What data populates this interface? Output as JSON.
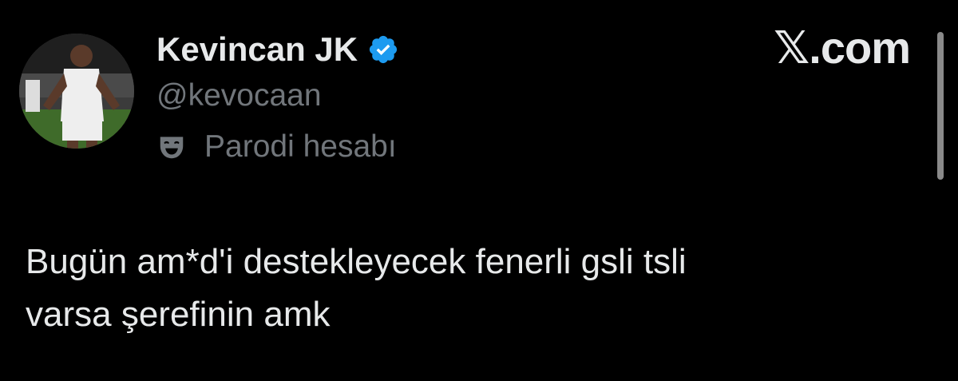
{
  "profile": {
    "display_name": "Kevincan JK",
    "handle": "@kevocaan",
    "verified_icon": "verified-badge-icon",
    "verified_color": "#1d9bf0",
    "label_icon": "parody-mask-icon",
    "label": "Parodi hesabı"
  },
  "brand": {
    "watermark": "𝕏.com"
  },
  "tweet": {
    "lines": [
      "Bugün am*d'i destekleyecek fenerli gsli tsli",
      "varsa şerefinin amk"
    ]
  },
  "colors": {
    "background": "#000000",
    "text_primary": "#e7e9ea",
    "text_secondary": "#71767b"
  }
}
